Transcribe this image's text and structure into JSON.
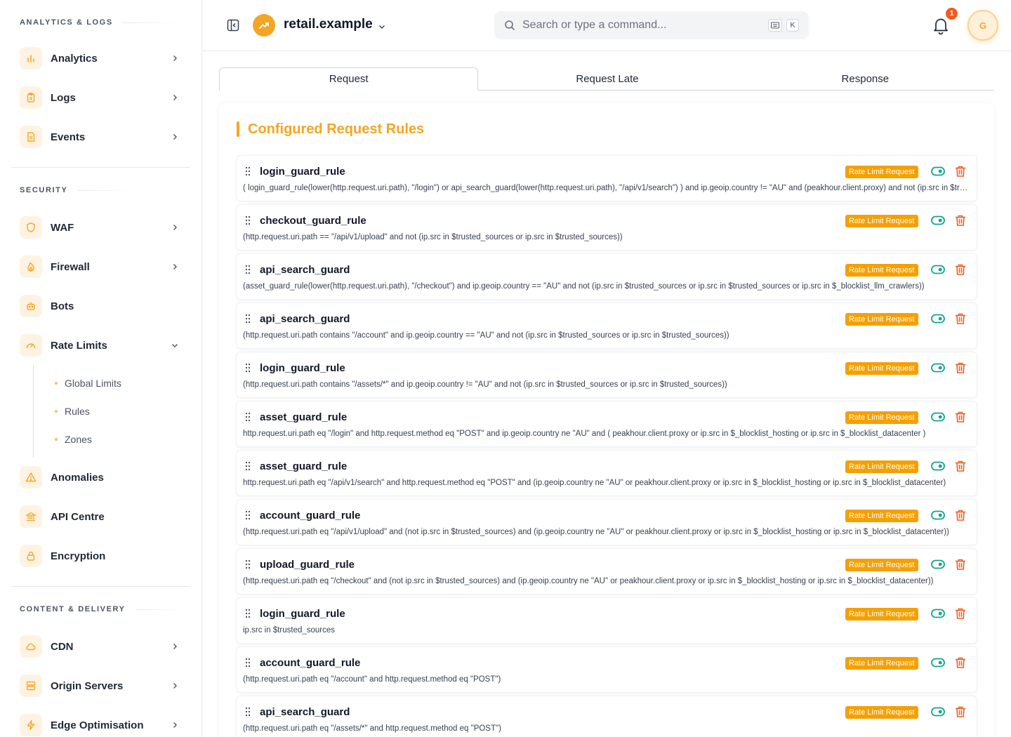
{
  "sidebar": {
    "sections": {
      "analytics": {
        "title": "ANALYTICS & LOGS",
        "items": [
          {
            "label": "Analytics",
            "icon": "bar-chart-icon"
          },
          {
            "label": "Logs",
            "icon": "clipboard-icon"
          },
          {
            "label": "Events",
            "icon": "document-icon"
          }
        ]
      },
      "security": {
        "title": "SECURITY",
        "items": [
          {
            "label": "WAF",
            "icon": "shield-icon"
          },
          {
            "label": "Firewall",
            "icon": "flame-icon"
          },
          {
            "label": "Bots",
            "icon": "robot-icon"
          },
          {
            "label": "Rate Limits",
            "icon": "gauge-icon",
            "expanded": true
          },
          {
            "label": "Anomalies",
            "icon": "warning-icon"
          },
          {
            "label": "API Centre",
            "icon": "bank-icon"
          },
          {
            "label": "Encryption",
            "icon": "lock-icon"
          }
        ],
        "rate_limit_sub": [
          "Global Limits",
          "Rules",
          "Zones"
        ]
      },
      "content": {
        "title": "CONTENT & DELIVERY",
        "items": [
          {
            "label": "CDN",
            "icon": "cloud-icon"
          },
          {
            "label": "Origin Servers",
            "icon": "server-icon"
          },
          {
            "label": "Edge Optimisation",
            "icon": "bolt-icon"
          }
        ]
      }
    }
  },
  "header": {
    "site_name": "retail.example",
    "search_placeholder": "Search or type a command...",
    "shortcut_key": "K",
    "notification_count": "1",
    "avatar_initial": "G"
  },
  "tabs": [
    {
      "label": "Request",
      "active": true
    },
    {
      "label": "Request Late",
      "active": false
    },
    {
      "label": "Response",
      "active": false
    }
  ],
  "main": {
    "title": "Configured Request Rules",
    "rules": [
      {
        "name": "login_guard_rule",
        "tag": "Rate Limit Request",
        "enabled": true,
        "expression": "( login_guard_rule(lower(http.request.uri.path), \"/login\") or api_search_guard(lower(http.request.uri.path), \"/api/v1/search\") ) and ip.geoip.country != \"AU\" and (peakhour.client.proxy) and not (ip.src in $trusted_sources or ip.src in $trusted_sources))"
      },
      {
        "name": "checkout_guard_rule",
        "tag": "Rate Limit Request",
        "enabled": true,
        "expression": "(http.request.uri.path == \"/api/v1/upload\" and not (ip.src in $trusted_sources or ip.src in $trusted_sources))"
      },
      {
        "name": "api_search_guard",
        "tag": "Rate Limit Request",
        "enabled": true,
        "expression": "(asset_guard_rule(lower(http.request.uri.path), \"/checkout\") and ip.geoip.country == \"AU\" and not (ip.src in $trusted_sources or ip.src in $trusted_sources or ip.src in $_blocklist_llm_crawlers))"
      },
      {
        "name": "api_search_guard",
        "tag": "Rate Limit Request",
        "enabled": true,
        "expression": "(http.request.uri.path contains \"/account\" and ip.geoip.country == \"AU\" and not (ip.src in $trusted_sources or ip.src in $trusted_sources))"
      },
      {
        "name": "login_guard_rule",
        "tag": "Rate Limit Request",
        "enabled": true,
        "expression": "(http.request.uri.path contains \"/assets/*\" and ip.geoip.country != \"AU\" and not (ip.src in $trusted_sources or ip.src in $trusted_sources))"
      },
      {
        "name": "asset_guard_rule",
        "tag": "Rate Limit Request",
        "enabled": true,
        "expression": "http.request.uri.path eq \"/login\" and http.request.method eq \"POST\" and ip.geoip.country ne \"AU\" and ( peakhour.client.proxy or ip.src in $_blocklist_hosting or ip.src in $_blocklist_datacenter )"
      },
      {
        "name": "asset_guard_rule",
        "tag": "Rate Limit Request",
        "enabled": true,
        "expression": "http.request.uri.path eq \"/api/v1/search\" and http.request.method eq \"POST\" and (ip.geoip.country ne \"AU\" or peakhour.client.proxy or ip.src in $_blocklist_hosting or ip.src in $_blocklist_datacenter)"
      },
      {
        "name": "account_guard_rule",
        "tag": "Rate Limit Request",
        "enabled": true,
        "expression": "(http.request.uri.path eq \"/api/v1/upload\" and (not ip.src in $trusted_sources) and (ip.geoip.country ne \"AU\" or peakhour.client.proxy or ip.src in $_blocklist_hosting or ip.src in $_blocklist_datacenter))"
      },
      {
        "name": "upload_guard_rule",
        "tag": "Rate Limit Request",
        "enabled": true,
        "expression": "(http.request.uri.path eq \"/checkout\" and (not ip.src in $trusted_sources) and (ip.geoip.country ne \"AU\" or peakhour.client.proxy or ip.src in $_blocklist_hosting or ip.src in $_blocklist_datacenter))"
      },
      {
        "name": "login_guard_rule",
        "tag": "Rate Limit Request",
        "enabled": true,
        "expression": "ip.src in $trusted_sources"
      },
      {
        "name": "account_guard_rule",
        "tag": "Rate Limit Request",
        "enabled": true,
        "expression": "(http.request.uri.path eq \"/account\" and http.request.method eq \"POST\")"
      },
      {
        "name": "api_search_guard",
        "tag": "Rate Limit Request",
        "enabled": true,
        "expression": "(http.request.uri.path eq \"/assets/*\" and http.request.method eq \"POST\")"
      }
    ]
  },
  "colors": {
    "accent": "#f5a524",
    "tag_bg": "#f5a000",
    "toggle": "#14a38b",
    "trash": "#f25c1f"
  }
}
